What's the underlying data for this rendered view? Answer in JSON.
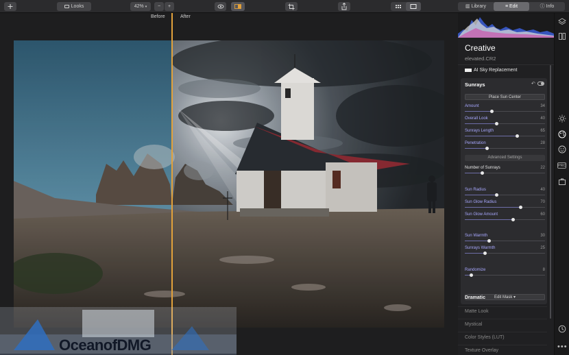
{
  "toolbar": {
    "looks_label": "Looks",
    "zoom_value": "42%",
    "zoom_minus": "−",
    "zoom_plus": "+",
    "tabs": [
      {
        "label": "Library",
        "active": false
      },
      {
        "label": "Edit",
        "active": true
      },
      {
        "label": "Info",
        "active": false
      }
    ]
  },
  "canvas": {
    "before_label": "Before",
    "after_label": "After",
    "split_color": "#e3a23b"
  },
  "panel": {
    "title": "Creative",
    "filename": "elevated.CR2",
    "sky_replacement_label": "AI Sky Replacement",
    "sunrays": {
      "title": "Sunrays",
      "place_sun_label": "Place Sun Center",
      "advanced_label": "Advanced Settings",
      "edit_mask_label": "Edit Mask ▾",
      "sliders_main": [
        {
          "label": "Amount",
          "value": "34",
          "pct": 0.34
        },
        {
          "label": "Overall Look",
          "value": "40",
          "pct": 0.4
        },
        {
          "label": "Sunrays Length",
          "value": "65",
          "pct": 0.65
        },
        {
          "label": "Penetration",
          "value": "28",
          "pct": 0.28
        }
      ],
      "number_of_sunrays": {
        "label": "Number of Sunrays",
        "value": "22",
        "pct": 0.22
      },
      "sliders_sun": [
        {
          "label": "Sun Radius",
          "value": "40",
          "pct": 0.4
        },
        {
          "label": "Sun Glow Radius",
          "value": "70",
          "pct": 0.7
        },
        {
          "label": "Sun Glow Amount",
          "value": "60",
          "pct": 0.6
        }
      ],
      "sliders_warmth": [
        {
          "label": "Sun Warmth",
          "value": "30",
          "pct": 0.3
        },
        {
          "label": "Sunrays Warmth",
          "value": "25",
          "pct": 0.25
        }
      ],
      "randomize": {
        "label": "Randomize",
        "value": "8",
        "pct": 0.08
      }
    },
    "filters": [
      {
        "label": "Dramatic",
        "bold": true
      },
      {
        "label": "Matte Look",
        "bold": false
      },
      {
        "label": "Mystical",
        "bold": false
      },
      {
        "label": "Color Styles (LUT)",
        "bold": false
      },
      {
        "label": "Texture Overlay",
        "bold": false
      }
    ]
  },
  "sidebar_icons": [
    "layers-icon",
    "compare-icon",
    "sun-icon",
    "palette-icon",
    "smile-icon",
    "pro-icon",
    "briefcase-icon",
    "clock-icon",
    "more-icon"
  ],
  "sidebar_pro_label": "PRO",
  "watermark": {
    "text": "OceanofDMG"
  }
}
